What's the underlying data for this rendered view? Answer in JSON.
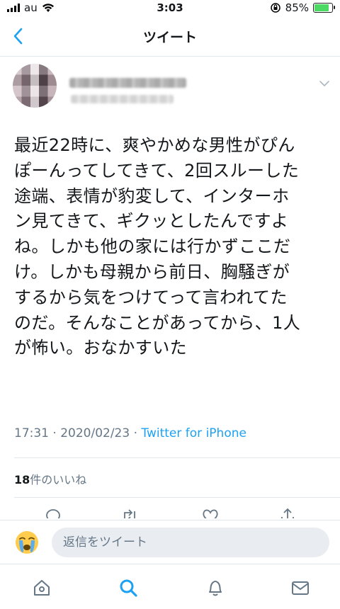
{
  "status_bar": {
    "carrier": "au",
    "time": "3:03",
    "battery": "85%",
    "battery_level": 0.85
  },
  "nav": {
    "title": "ツイート"
  },
  "tweet": {
    "text_lines": [
      "最近22時に、爽やかめな男性がぴん",
      "ぽーんってしてきて、2回スルーした",
      "途端、表情が豹変して、インターホ",
      "ン見てきて、ギクッとしたんですよ",
      "ね。しかも他の家には行かずここだ",
      "け。しかも母親から前日、胸騒ぎが",
      "するから気をつけてって言われてた",
      "のだ。そんなことがあってから、1人",
      "が怖い。おなかすいた"
    ],
    "timestamp": "17:31 · 2020/02/23 · ",
    "source": "Twitter for iPhone",
    "likes_count": "18",
    "likes_label": "件のいいね"
  },
  "reply": {
    "placeholder": "返信をツイート"
  },
  "colors": {
    "accent": "#1da1f2",
    "muted": "#657786",
    "text": "#14171a"
  }
}
